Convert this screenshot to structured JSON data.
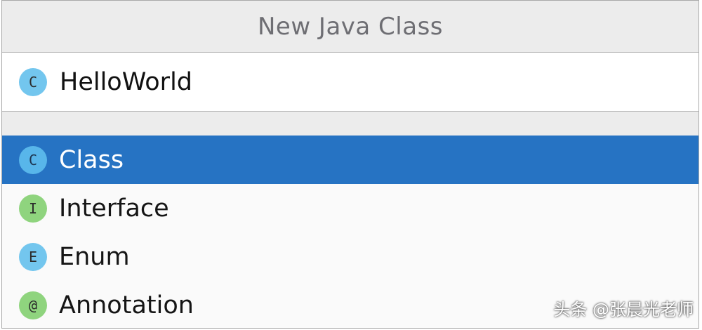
{
  "dialog": {
    "title": "New Java Class"
  },
  "name_field": {
    "icon": "class-icon",
    "badge_letter": "C",
    "value": "HelloWorld"
  },
  "kinds": [
    {
      "label": "Class",
      "badge_letter": "C",
      "icon": "class-icon",
      "color": "#73c6ee",
      "selected": true
    },
    {
      "label": "Interface",
      "badge_letter": "I",
      "icon": "interface-icon",
      "color": "#8fd47e",
      "selected": false
    },
    {
      "label": "Enum",
      "badge_letter": "E",
      "icon": "enum-icon",
      "color": "#73c6ee",
      "selected": false
    },
    {
      "label": "Annotation",
      "badge_letter": "@",
      "icon": "annotation-icon",
      "color": "#8fd47e",
      "selected": false
    }
  ],
  "colors": {
    "selection": "#2673c3",
    "title_bar": "#ececec"
  },
  "watermark": "头条 @张晨光老师"
}
